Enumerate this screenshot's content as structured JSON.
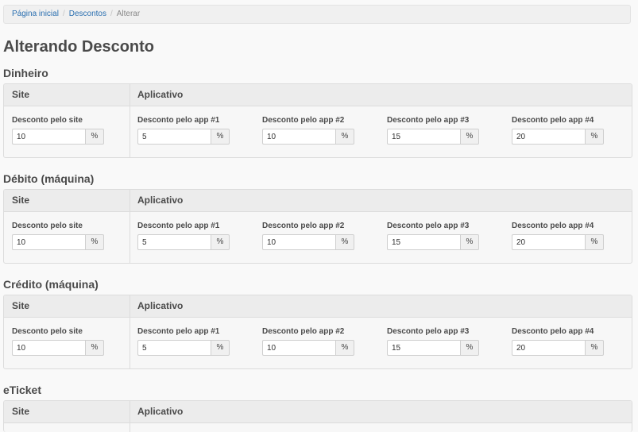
{
  "breadcrumb": {
    "items": [
      {
        "label": "Página inicial"
      },
      {
        "label": "Descontos"
      },
      {
        "label": "Alterar"
      }
    ],
    "separator": "/"
  },
  "page_title": "Alterando Desconto",
  "columns": {
    "site": "Site",
    "app": "Aplicativo"
  },
  "labels": {
    "site": "Desconto pelo site",
    "app1": "Desconto pelo app #1",
    "app2": "Desconto pelo app #2",
    "app3": "Desconto pelo app #3",
    "app4": "Desconto pelo app #4"
  },
  "unit": "%",
  "sections": [
    {
      "title": "Dinheiro",
      "values": {
        "site": "10",
        "app1": "5",
        "app2": "10",
        "app3": "15",
        "app4": "20"
      }
    },
    {
      "title": "Débito (máquina)",
      "values": {
        "site": "10",
        "app1": "5",
        "app2": "10",
        "app3": "15",
        "app4": "20"
      }
    },
    {
      "title": "Crédito (máquina)",
      "values": {
        "site": "10",
        "app1": "5",
        "app2": "10",
        "app3": "15",
        "app4": "20"
      }
    },
    {
      "title": "eTicket"
    }
  ]
}
